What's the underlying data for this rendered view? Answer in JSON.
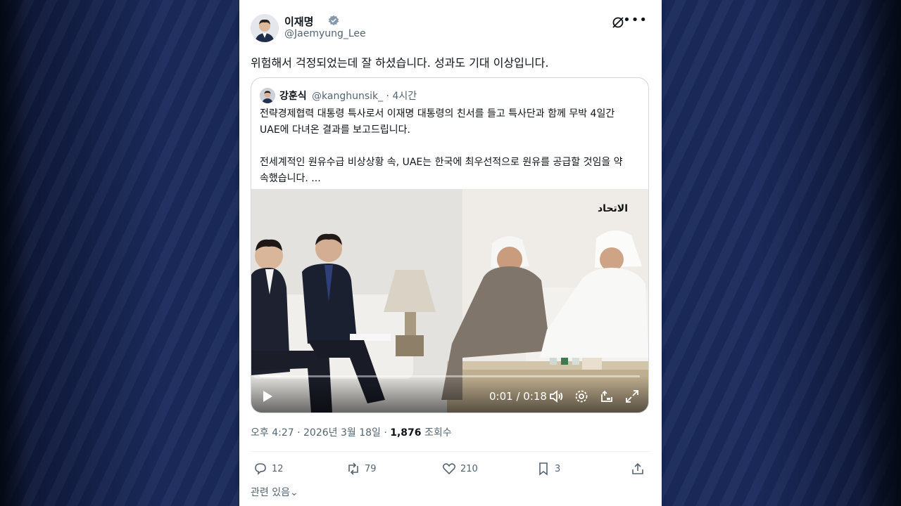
{
  "post": {
    "display_name": "이재명",
    "handle": "@Jaemyung_Lee",
    "text": "위험해서 걱정되었는데 잘 하셨습니다. 성과도 기대 이상입니다.",
    "timestamp": "오후 4:27 · 2026년 3월 18일 · ",
    "views_count": "1,876",
    "views_label": " 조회수"
  },
  "quote": {
    "display_name": "강훈식",
    "handle": "@kanghunsik_ · 4시간",
    "paragraph1_line1": "전략경제협력 대통령 특사로서 이재명 대통령의 친서를 들고 특사단과 함께 무박 4일간",
    "paragraph1_line2": "UAE에 다녀온 결과를 보고드립니다.",
    "paragraph2_line1": "전세계적인 원유수급 비상상황 속, UAE는 한국에 최우선적으로 원유를 공급할 것임을 약",
    "paragraph2_line2": "속했습니다. ...",
    "video": {
      "time": "0:01 / 0:18",
      "progress": 0.055
    }
  },
  "actions": {
    "replies": "12",
    "reposts": "79",
    "likes": "210",
    "bookmarks": "3"
  },
  "related_label": "관련 있음",
  "colors": {
    "background": "#14204a",
    "verified": "#829aab",
    "text": "#0f1419",
    "muted": "#536471"
  }
}
